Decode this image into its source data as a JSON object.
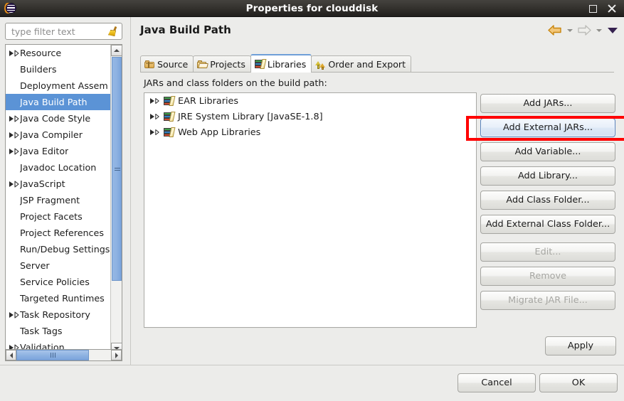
{
  "window": {
    "title": "Properties for clouddisk",
    "app_icon": "eclipse-icon",
    "maximize_label": "",
    "close_label": ""
  },
  "sidebar": {
    "filter": {
      "value": "",
      "placeholder": "type filter text",
      "clear_icon": "broom-icon"
    },
    "items": [
      {
        "label": "Resource",
        "expandable": true,
        "selected": false
      },
      {
        "label": "Builders",
        "expandable": false,
        "selected": false
      },
      {
        "label": "Deployment Assem",
        "expandable": false,
        "selected": false
      },
      {
        "label": "Java Build Path",
        "expandable": false,
        "selected": true
      },
      {
        "label": "Java Code Style",
        "expandable": true,
        "selected": false
      },
      {
        "label": "Java Compiler",
        "expandable": true,
        "selected": false
      },
      {
        "label": "Java Editor",
        "expandable": true,
        "selected": false
      },
      {
        "label": "Javadoc Location",
        "expandable": false,
        "selected": false
      },
      {
        "label": "JavaScript",
        "expandable": true,
        "selected": false
      },
      {
        "label": "JSP Fragment",
        "expandable": false,
        "selected": false
      },
      {
        "label": "Project Facets",
        "expandable": false,
        "selected": false
      },
      {
        "label": "Project References",
        "expandable": false,
        "selected": false
      },
      {
        "label": "Run/Debug Settings",
        "expandable": false,
        "selected": false
      },
      {
        "label": "Server",
        "expandable": false,
        "selected": false
      },
      {
        "label": "Service Policies",
        "expandable": false,
        "selected": false
      },
      {
        "label": "Targeted Runtimes",
        "expandable": false,
        "selected": false
      },
      {
        "label": "Task Repository",
        "expandable": true,
        "selected": false
      },
      {
        "label": "Task Tags",
        "expandable": false,
        "selected": false
      },
      {
        "label": "Validation",
        "expandable": true,
        "selected": false
      }
    ],
    "help_label": "?"
  },
  "pane": {
    "title": "Java Build Path",
    "nav": {
      "back_icon": "back-arrow-icon",
      "back_menu_icon": "chevron-down-icon",
      "forward_icon": "forward-arrow-icon",
      "forward_menu_icon": "chevron-down-icon",
      "view_menu_icon": "view-menu-triangle-icon"
    },
    "tabs": [
      {
        "label": "Source",
        "icon": "source-folder-icon",
        "active": false
      },
      {
        "label": "Projects",
        "icon": "open-folder-icon",
        "active": false
      },
      {
        "label": "Libraries",
        "icon": "libraries-books-icon",
        "active": true
      },
      {
        "label": "Order and Export",
        "icon": "order-export-arrows-icon",
        "active": false
      }
    ],
    "caption": "JARs and class folders on the build path:",
    "entries": [
      {
        "label": "EAR Libraries",
        "icon": "libraries-books-icon",
        "expandable": true
      },
      {
        "label": "JRE System Library [JavaSE-1.8]",
        "icon": "libraries-books-icon",
        "expandable": true
      },
      {
        "label": "Web App Libraries",
        "icon": "libraries-books-icon",
        "expandable": true
      }
    ],
    "buttons": [
      {
        "label": "Add JARs...",
        "state": "normal"
      },
      {
        "label": "Add External JARs...",
        "state": "focused"
      },
      {
        "label": "Add Variable...",
        "state": "normal"
      },
      {
        "label": "Add Library...",
        "state": "normal"
      },
      {
        "label": "Add Class Folder...",
        "state": "normal"
      },
      {
        "label": "Add External Class Folder...",
        "state": "normal"
      },
      {
        "label": "Edit...",
        "state": "disabled"
      },
      {
        "label": "Remove",
        "state": "disabled"
      },
      {
        "label": "Migrate JAR File...",
        "state": "disabled"
      }
    ],
    "apply_label": "Apply"
  },
  "footer": {
    "cancel_label": "Cancel",
    "ok_label": "OK"
  },
  "colors": {
    "titlebar": "#2e2c28",
    "selection": "#5b93d6",
    "highlight_rect": "#ff0000",
    "focus_border": "#5a83bb",
    "dialog_bg": "#ececea"
  }
}
